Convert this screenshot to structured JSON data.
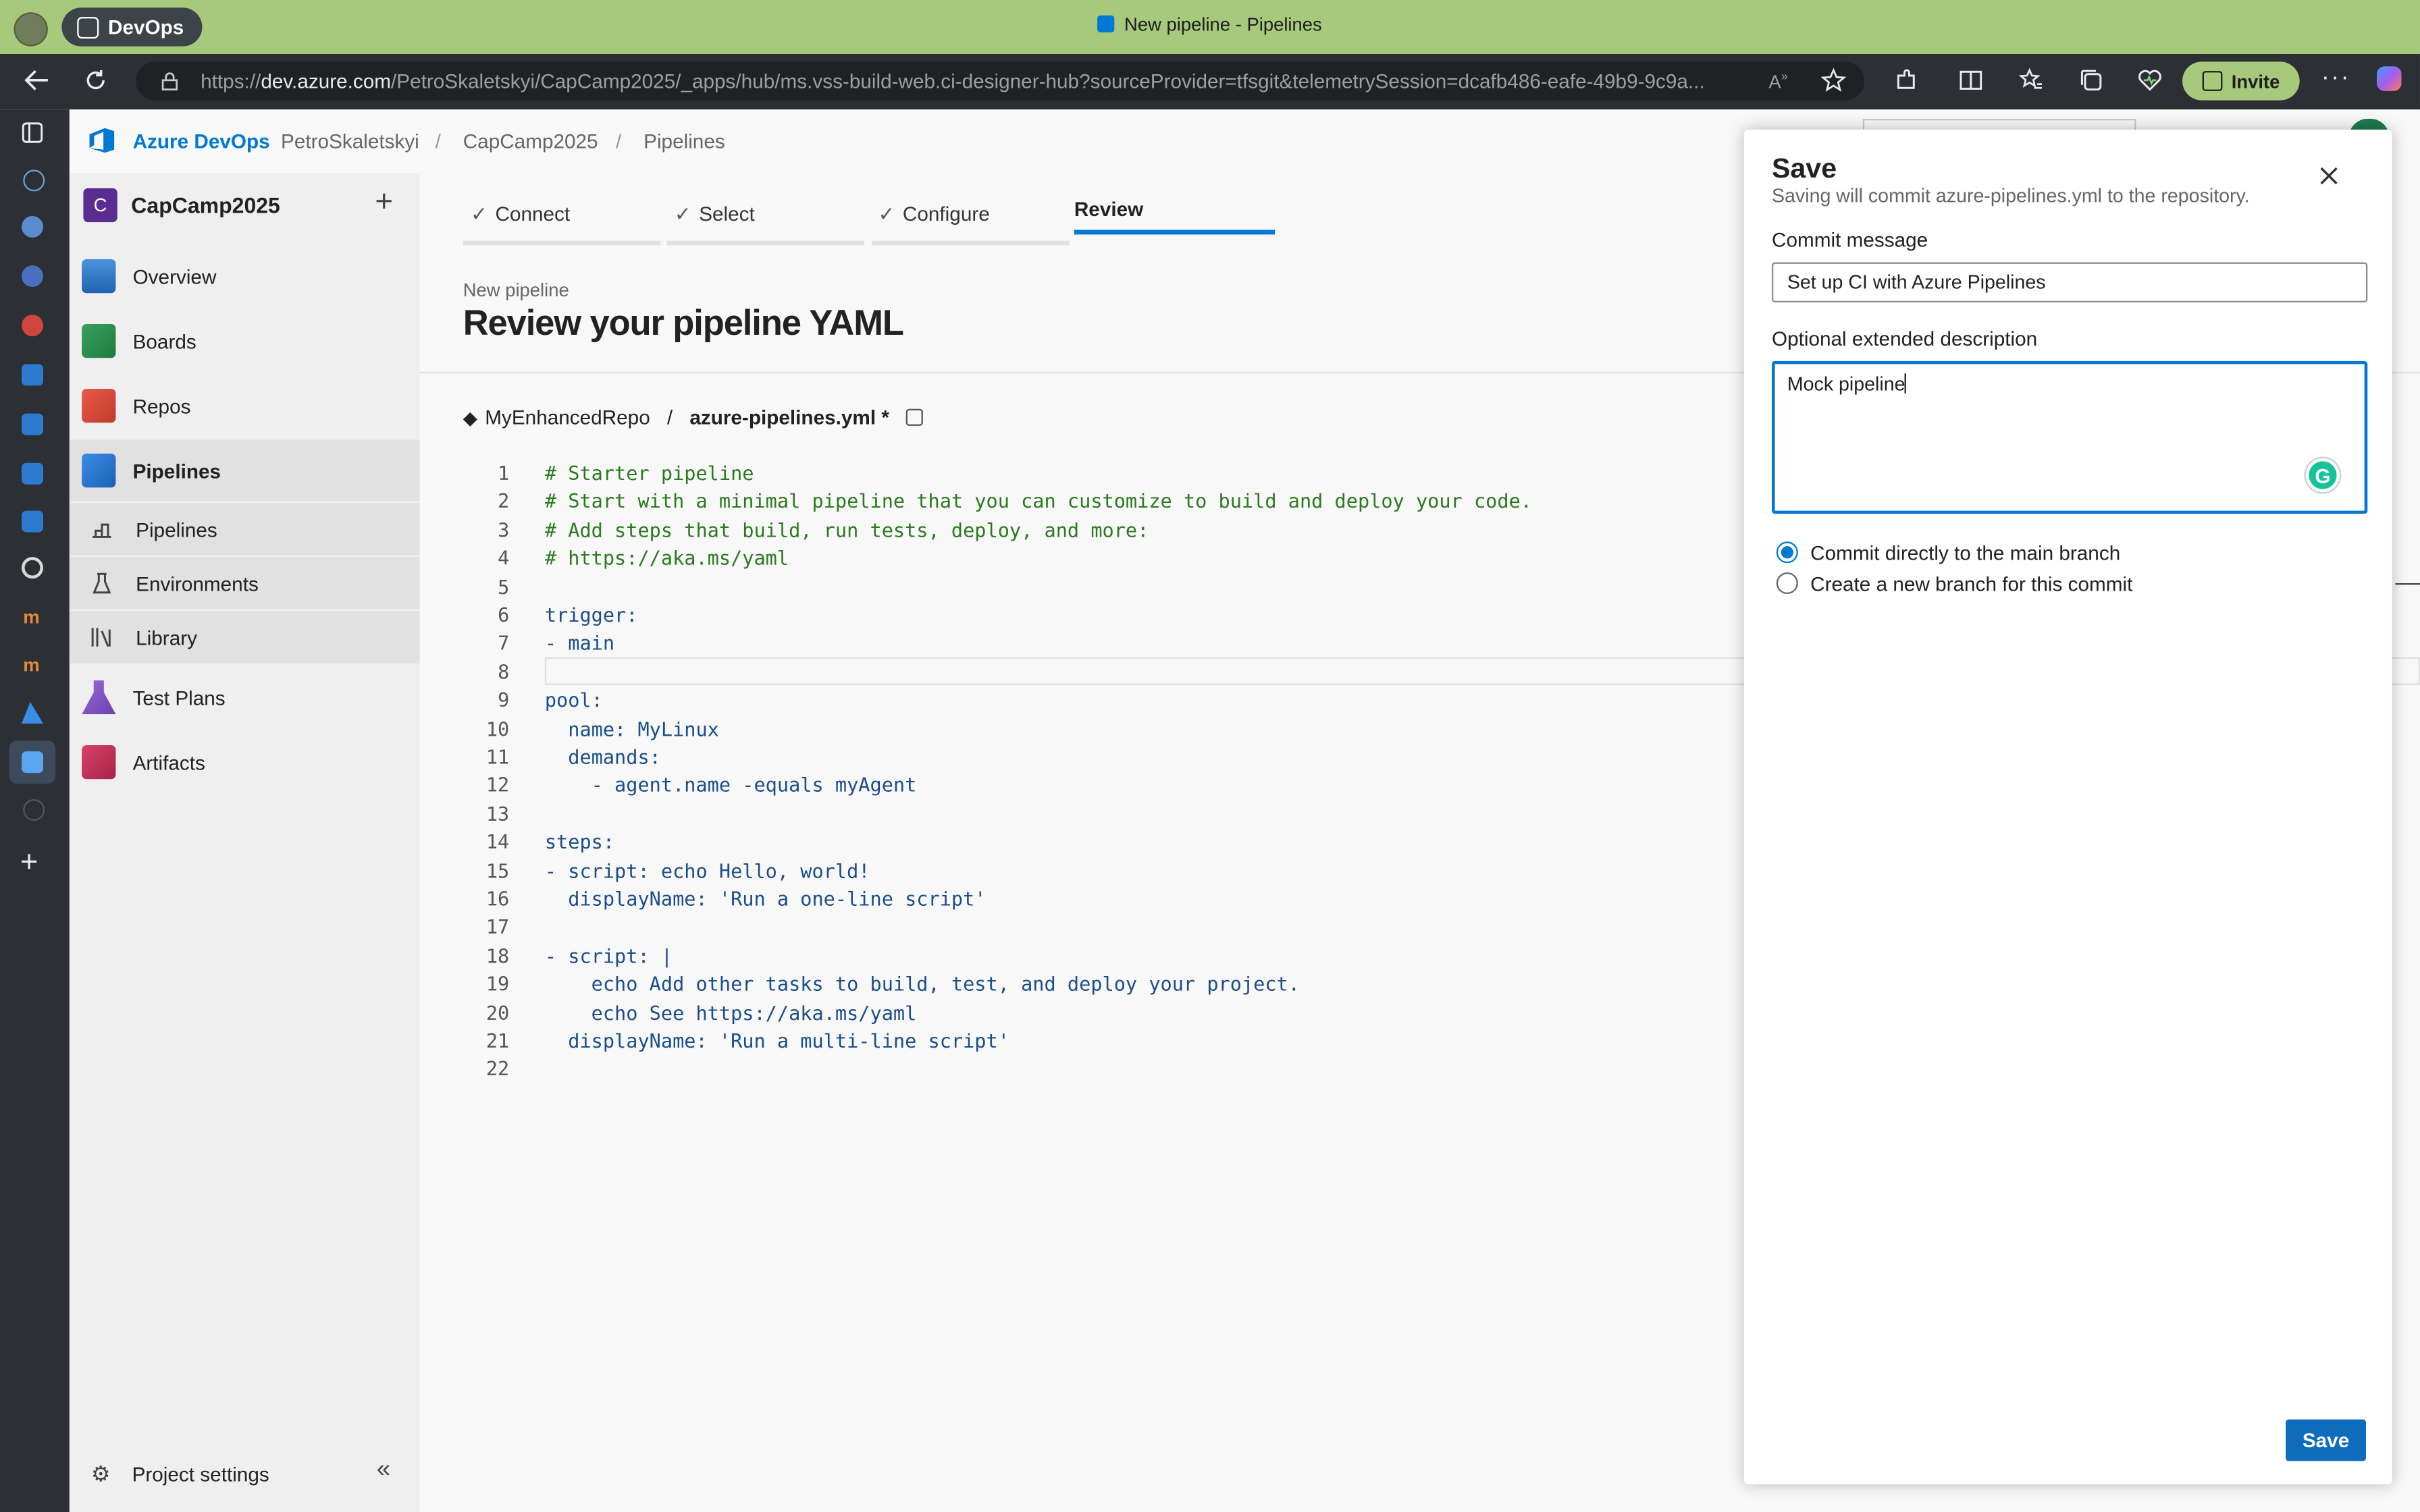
{
  "browser": {
    "tab_label": "DevOps",
    "window_title": "New pipeline - Pipelines",
    "url_prefix": "https://",
    "url_host": "dev.azure.com",
    "url_path": "/PetroSkaletskyi/CapCamp2025/_apps/hub/ms.vss-build-web.ci-designer-hub?sourceProvider=tfsgit&telemetrySession=dcafb486-eafe-49b9-9c9a...",
    "invite_label": "Invite"
  },
  "header": {
    "brand": "Azure DevOps",
    "org": "PetroSkaletskyi",
    "project": "CapCamp2025",
    "section": "Pipelines",
    "sep": "/"
  },
  "sidebar": {
    "project_initial": "C",
    "project_name": "CapCamp2025",
    "add": "+",
    "items": [
      {
        "label": "Overview"
      },
      {
        "label": "Boards"
      },
      {
        "label": "Repos"
      },
      {
        "label": "Pipelines"
      },
      {
        "label": "Pipelines"
      },
      {
        "label": "Environments"
      },
      {
        "label": "Library"
      },
      {
        "label": "Test Plans"
      },
      {
        "label": "Artifacts"
      }
    ],
    "settings_label": "Project settings",
    "collapse": "«"
  },
  "wizard": {
    "steps": [
      {
        "label": "Connect",
        "check": "✓"
      },
      {
        "label": "Select",
        "check": "✓"
      },
      {
        "label": "Configure",
        "check": "✓"
      },
      {
        "label": "Review",
        "check": ""
      }
    ],
    "subtitle": "New pipeline",
    "title": "Review your pipeline YAML"
  },
  "file": {
    "repo": "MyEnhancedRepo",
    "sep": "/",
    "name": "azure-pipelines.yml *"
  },
  "code_lines": [
    "# Starter pipeline",
    "# Start with a minimal pipeline that you can customize to build and deploy your code.",
    "# Add steps that build, run tests, deploy, and more:",
    "# https://aka.ms/yaml",
    "",
    "trigger:",
    "- main",
    "",
    "pool:",
    "  name: MyLinux",
    "  demands:",
    "    - agent.name -equals myAgent",
    "",
    "steps:",
    "- script: echo Hello, world!",
    "  displayName: 'Run a one-line script'",
    "",
    "- script: |",
    "    echo Add other tasks to build, test, and deploy your project.",
    "    echo See https://aka.ms/yaml",
    "  displayName: 'Run a multi-line script'",
    ""
  ],
  "line_numbers": [
    "1",
    "2",
    "3",
    "4",
    "5",
    "6",
    "7",
    "8",
    "9",
    "10",
    "11",
    "12",
    "13",
    "14",
    "15",
    "16",
    "17",
    "18",
    "19",
    "20",
    "21",
    "22"
  ],
  "panel": {
    "title": "Save",
    "subtitle": "Saving will commit azure-pipelines.yml to the repository.",
    "commit_label": "Commit message",
    "commit_value": "Set up CI with Azure Pipelines",
    "desc_label": "Optional extended description",
    "desc_value": "Mock pipeline",
    "radio_main": "Commit directly to the main branch",
    "radio_new": "Create a new branch for this commit",
    "save_label": "Save"
  },
  "colors": {
    "accent": "#0078d4",
    "titlebar": "#a6c97c",
    "save_button": "#0f6cbd"
  }
}
